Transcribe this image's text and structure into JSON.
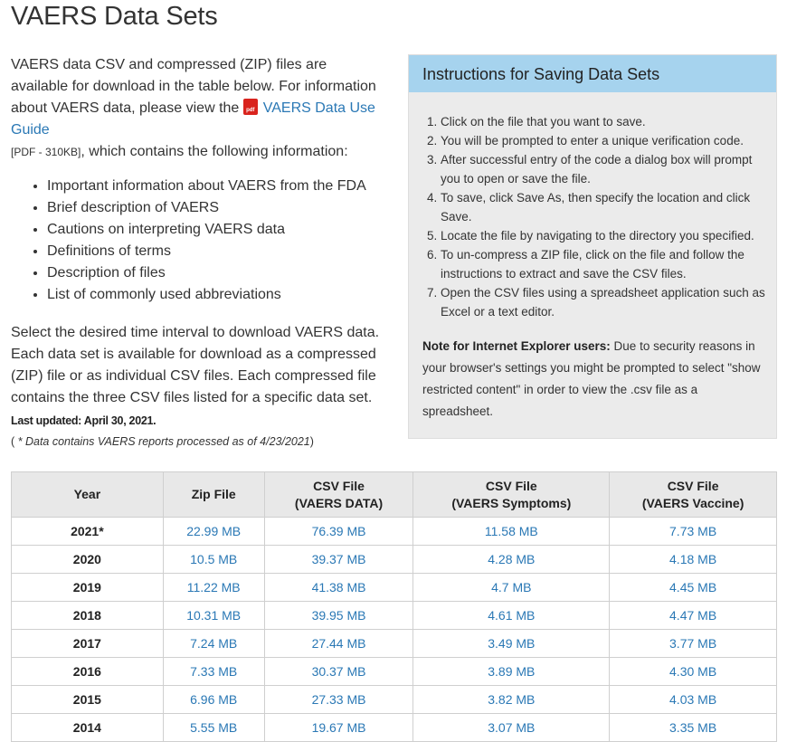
{
  "title": "VAERS Data Sets",
  "intro": {
    "part1": "VAERS data CSV and compressed (ZIP) files are available for download in the table below. For information about VAERS data, please view the ",
    "pdf_icon_text": "pdf",
    "guide_link": "VAERS Data Use Guide",
    "pdf_size": "[PDF - 310KB]",
    "part2": ", which contains the following information:",
    "bullets": [
      "Important information about VAERS from the FDA",
      "Brief description of VAERS",
      "Cautions on interpreting VAERS data",
      "Definitions of terms",
      "Description of files",
      "List of commonly used abbreviations"
    ],
    "select_text": "Select the desired time interval to download VAERS data. Each data set is available for download as a compressed (ZIP) file or as individual CSV files. Each compressed file contains the three CSV files listed for a specific data set."
  },
  "last_updated": "Last updated: April 30, 2021.",
  "note_open": "( ",
  "note_text": "* Data contains VAERS reports processed as of 4/23/2021",
  "note_close": ")",
  "instructions": {
    "header": "Instructions for Saving Data Sets",
    "steps": [
      "Click on the file that you want to save.",
      "You will be prompted to enter a unique verification code.",
      "After successful entry of the code a dialog box will prompt you to open or save the file.",
      "To save, click Save As, then specify the location and click Save.",
      "Locate the file by navigating to the directory you specified.",
      "To un-compress a ZIP file, click on the file and follow the instructions to extract and save the CSV files.",
      "Open the CSV files using a spreadsheet application such as Excel or a text editor."
    ],
    "ie_label": "Note for Internet Explorer users:",
    "ie_text": " Due to security reasons in your browser's settings you might be prompted to select \"show restricted content\" in order to view the .csv file as a spreadsheet."
  },
  "table": {
    "headers": {
      "year": "Year",
      "zip": "Zip File",
      "csv_data_1": "CSV File",
      "csv_data_2": "(VAERS DATA)",
      "csv_sym_1": "CSV File",
      "csv_sym_2": "(VAERS Symptoms)",
      "csv_vax_1": "CSV File",
      "csv_vax_2": "(VAERS Vaccine)"
    },
    "rows": [
      {
        "year": "2021*",
        "zip": "22.99 MB",
        "data": "76.39 MB",
        "symptoms": "11.58 MB",
        "vaccine": "7.73 MB"
      },
      {
        "year": "2020",
        "zip": "10.5 MB",
        "data": "39.37 MB",
        "symptoms": "4.28 MB",
        "vaccine": "4.18 MB"
      },
      {
        "year": "2019",
        "zip": "11.22 MB",
        "data": "41.38 MB",
        "symptoms": "4.7 MB",
        "vaccine": "4.45 MB"
      },
      {
        "year": "2018",
        "zip": "10.31 MB",
        "data": "39.95 MB",
        "symptoms": "4.61 MB",
        "vaccine": "4.47 MB"
      },
      {
        "year": "2017",
        "zip": "7.24 MB",
        "data": "27.44 MB",
        "symptoms": "3.49 MB",
        "vaccine": "3.77 MB"
      },
      {
        "year": "2016",
        "zip": "7.33 MB",
        "data": "30.37 MB",
        "symptoms": "3.89 MB",
        "vaccine": "4.30 MB"
      },
      {
        "year": "2015",
        "zip": "6.96 MB",
        "data": "27.33 MB",
        "symptoms": "3.82 MB",
        "vaccine": "4.03 MB"
      },
      {
        "year": "2014",
        "zip": "5.55 MB",
        "data": "19.67 MB",
        "symptoms": "3.07 MB",
        "vaccine": "3.35 MB"
      }
    ]
  }
}
